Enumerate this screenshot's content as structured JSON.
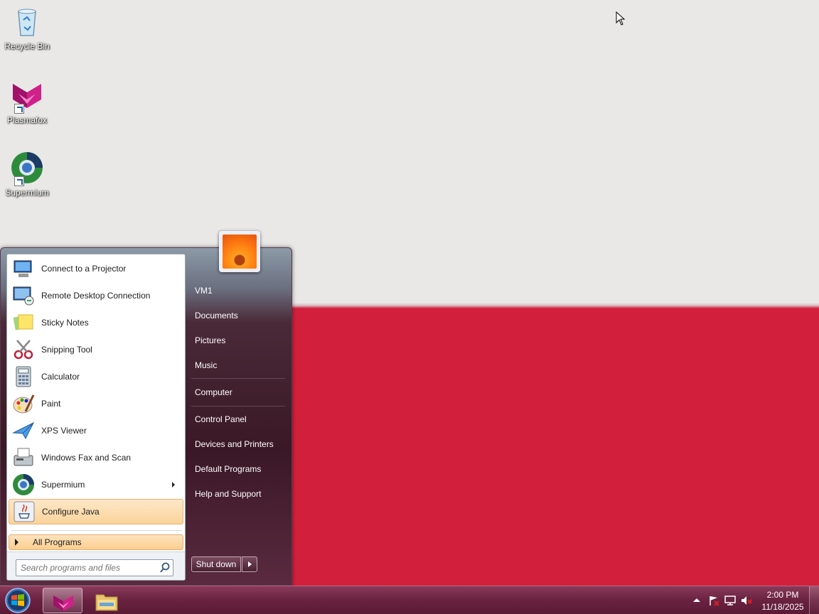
{
  "desktop": {
    "icons": [
      {
        "label": "Recycle Bin",
        "icon": "recycle-bin-icon"
      },
      {
        "label": "Plasmafox",
        "icon": "plasmafox-icon"
      },
      {
        "label": "Supermium",
        "icon": "supermium-icon"
      }
    ],
    "wallpaper_colors": {
      "top": "#e9e8e6",
      "bottom": "#d21f3c"
    }
  },
  "start_menu": {
    "programs": [
      {
        "label": "Connect to a Projector",
        "icon": "projector-icon"
      },
      {
        "label": "Remote Desktop Connection",
        "icon": "remote-desktop-icon"
      },
      {
        "label": "Sticky Notes",
        "icon": "sticky-notes-icon"
      },
      {
        "label": "Snipping Tool",
        "icon": "scissors-icon"
      },
      {
        "label": "Calculator",
        "icon": "calculator-icon"
      },
      {
        "label": "Paint",
        "icon": "paint-icon"
      },
      {
        "label": "XPS Viewer",
        "icon": "xps-viewer-icon"
      },
      {
        "label": "Windows Fax and Scan",
        "icon": "fax-icon"
      },
      {
        "label": "Supermium",
        "icon": "supermium-icon",
        "has_submenu": true
      },
      {
        "label": "Configure Java",
        "icon": "java-icon",
        "highlighted": true
      }
    ],
    "all_programs": "All Programs",
    "search_placeholder": "Search programs and files",
    "user": "VM1",
    "right_links": [
      "Documents",
      "Pictures",
      "Music",
      "Computer",
      "Control Panel",
      "Devices and Printers",
      "Default Programs",
      "Help and Support"
    ],
    "shutdown_label": "Shut down"
  },
  "taskbar": {
    "pinned": [
      {
        "name": "Plasmafox",
        "icon": "plasmafox-icon",
        "active": true
      },
      {
        "name": "Windows Explorer",
        "icon": "folder-icon",
        "active": false
      }
    ],
    "tray_icons": [
      "show-hidden-icons-arrow",
      "action-center-flag-icon",
      "network-icon",
      "volume-muted-icon"
    ],
    "clock": {
      "time": "2:00 PM",
      "date": "11/18/2025"
    }
  }
}
